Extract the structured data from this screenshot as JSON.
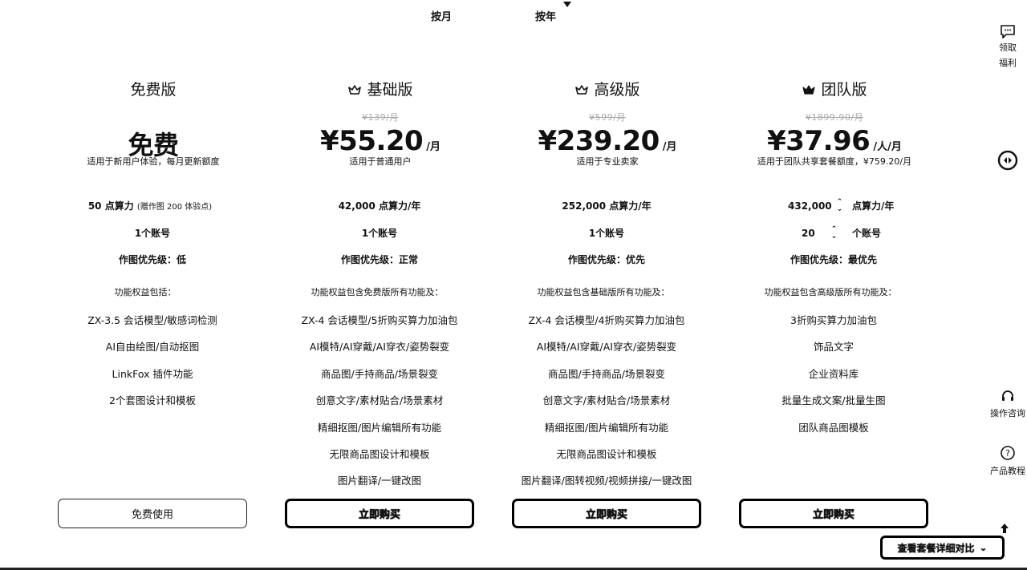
{
  "billing_toggle": {
    "month_label": "按月",
    "year_label": "按年"
  },
  "plans": [
    {
      "name": "免费版",
      "original_price": "",
      "price": "免费",
      "unit": "",
      "description": "适用于新用户体验，每月更新额度",
      "quota": "50 点算力",
      "quota_note": "(赠作图 200 体验点)",
      "accounts": "1个账号",
      "priority_label": "作图优先级：",
      "priority_value": "低",
      "features_title": "功能权益包括：",
      "features": [
        "ZX-3.5 会话模型/敏感词检测",
        "AI自由绘图/自动抠图",
        "LinkFox 插件功能",
        "2个套图设计和模板"
      ],
      "button": "免费使用"
    },
    {
      "name": "基础版",
      "original_price": "¥139/月",
      "price": "¥55.20",
      "unit": "/月",
      "description": "适用于普通用户",
      "quota": "42,000 点算力/年",
      "accounts": "1个账号",
      "priority_label": "作图优先级：",
      "priority_value": "正常",
      "features_title": "功能权益包含免费版所有功能及：",
      "features": [
        "ZX-4 会话模型/5折购买算力加油包",
        "AI模特/AI穿戴/AI穿衣/姿势裂变",
        "商品图/手持商品/场景裂变",
        "创意文字/素材贴合/场景素材",
        "精细抠图/图片编辑所有功能",
        "无限商品图设计和模板",
        "图片翻译/一键改图"
      ],
      "button": "立即购买"
    },
    {
      "name": "高级版",
      "original_price": "¥599/月",
      "price": "¥239.20",
      "unit": "/月",
      "description": "适用于专业卖家",
      "quota": "252,000 点算力/年",
      "accounts": "1个账号",
      "priority_label": "作图优先级：",
      "priority_value": "优先",
      "features_title": "功能权益包含基础版所有功能及：",
      "features": [
        "ZX-4 会话模型/4折购买算力加油包",
        "AI模特/AI穿戴/AI穿衣/姿势裂变",
        "商品图/手持商品/场景裂变",
        "创意文字/素材贴合/场景素材",
        "精细抠图/图片编辑所有功能",
        "无限商品图设计和模板",
        "图片翻译/图转视频/视频拼接/一键改图"
      ],
      "button": "立即购买"
    },
    {
      "name": "团队版",
      "original_price": "¥1899.90/月",
      "price": "¥37.96",
      "unit": "/人/月",
      "description": "适用于团队共享套餐额度，¥759.20/月",
      "quota_value": "432,000",
      "quota_suffix": "点算力/年",
      "accounts_value": "20",
      "accounts_suffix": "个账号",
      "priority_label": "作图优先级：",
      "priority_value": "最优先",
      "features_title": "功能权益包含高级版所有功能及：",
      "features": [
        "3折购买算力加油包",
        "饰品文字",
        "企业资料库",
        "批量生成文案/批量生图",
        "团队商品图模板"
      ],
      "button": "立即购买"
    }
  ],
  "sidebar": {
    "welfare_label_1": "领取",
    "welfare_label_2": "福利",
    "consult_label": "操作咨询",
    "tutorial_label": "产品教程"
  },
  "compare_button": "查看套餐详细对比",
  "colors": {
    "text": "#111111",
    "muted": "#aaaaaa",
    "background": "#ffffff",
    "border": "#000000"
  }
}
